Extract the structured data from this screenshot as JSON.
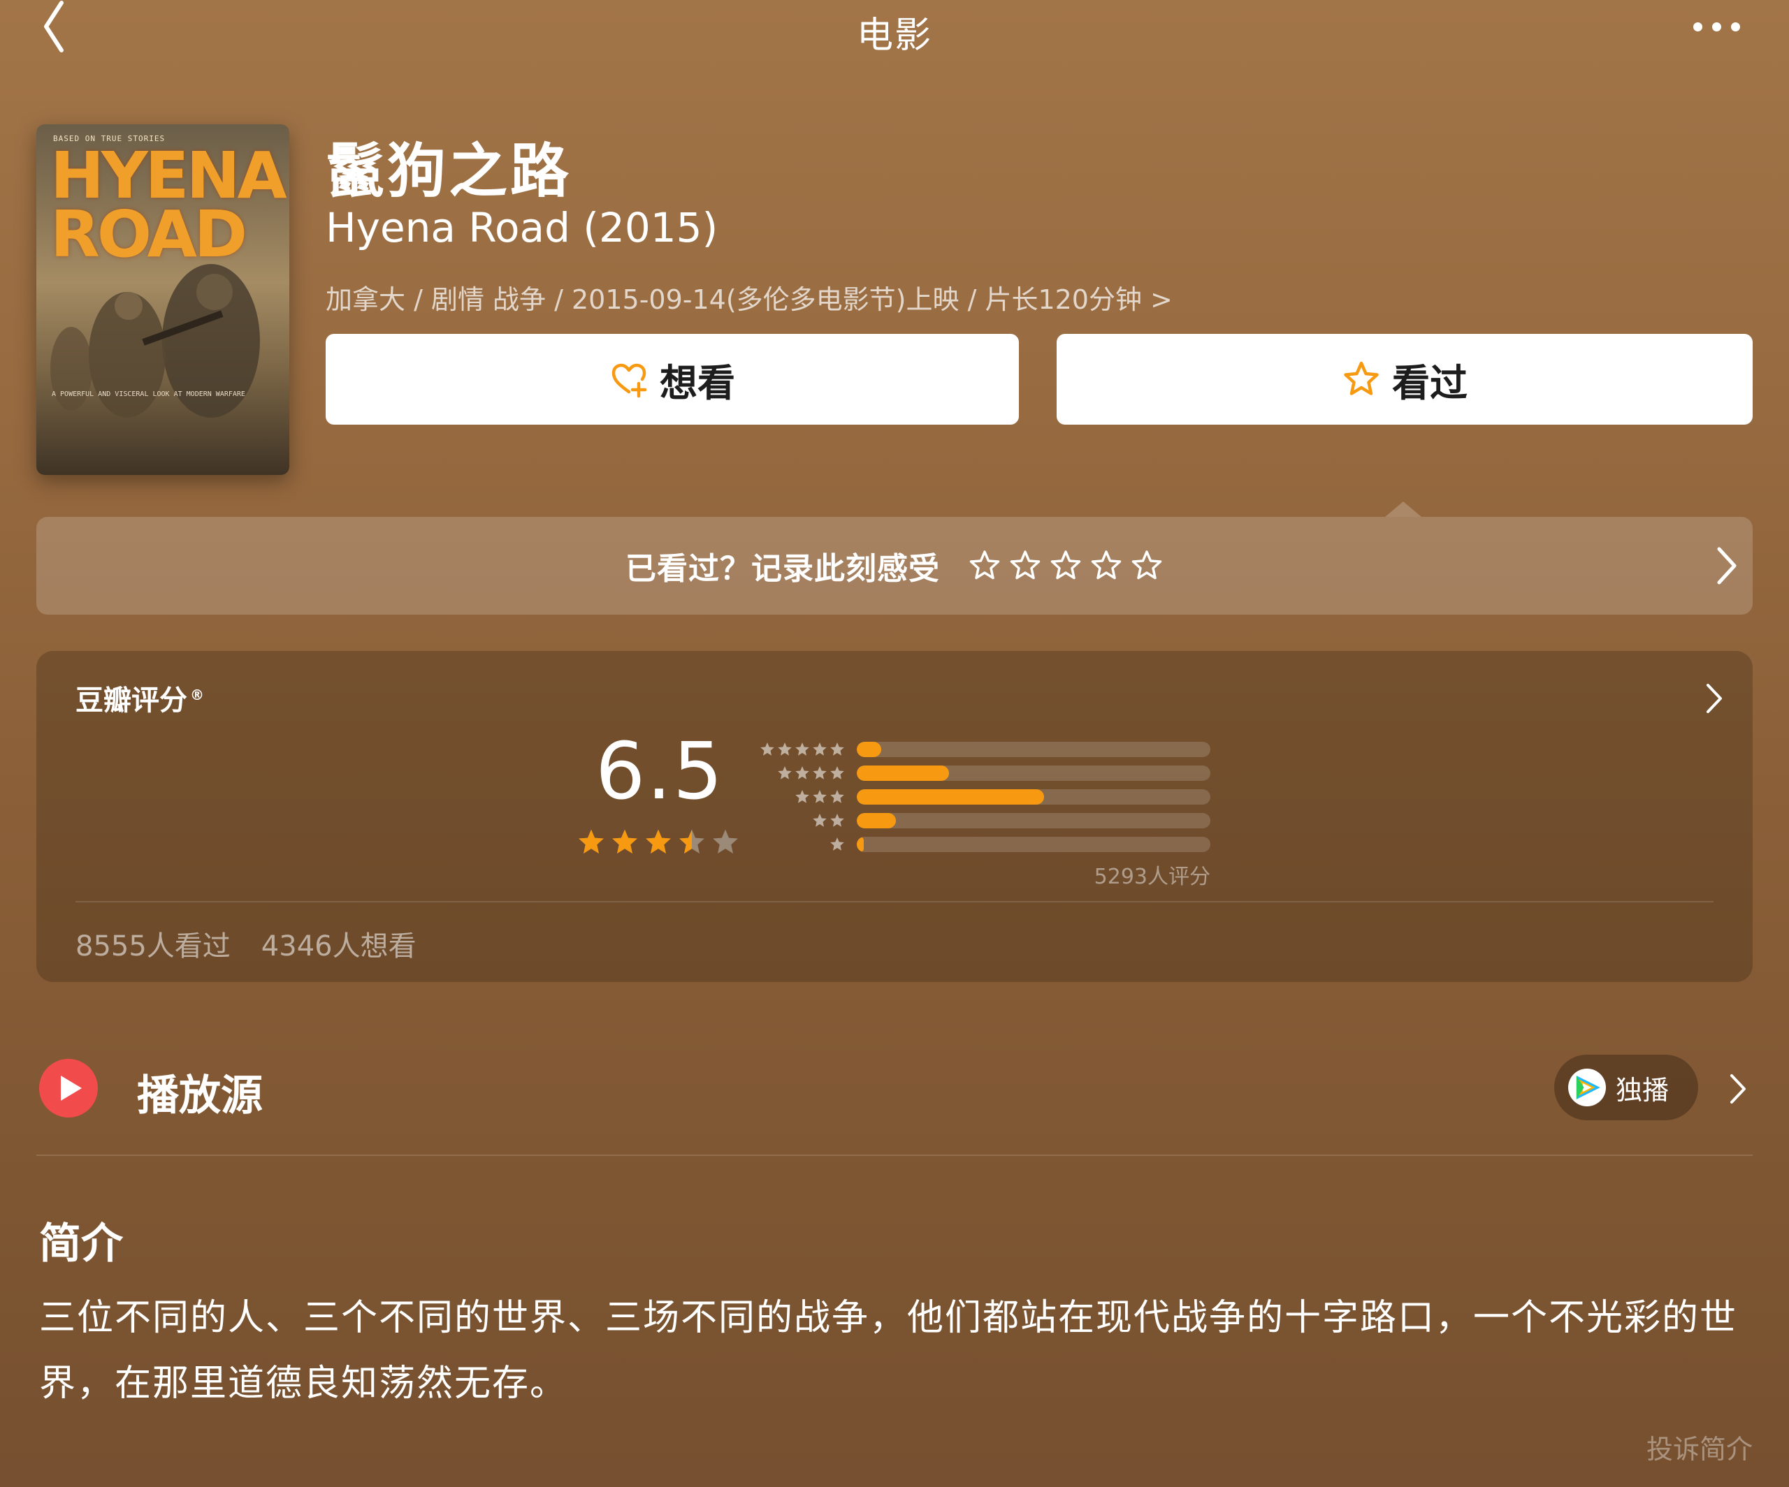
{
  "nav": {
    "title": "电影"
  },
  "poster": {
    "tagline": "BASED ON TRUE STORIES",
    "title_line1": "HYENA",
    "title_line2": "ROAD",
    "footer": "A POWERFUL AND VISCERAL LOOK AT MODERN WARFARE"
  },
  "movie": {
    "title_cn": "鬣狗之路",
    "title_en": "Hyena Road (2015)",
    "meta": "加拿大 / 剧情 战争 / 2015-09-14(多伦多电影节)上映 / 片长120分钟 >"
  },
  "actions": {
    "want_label": "想看",
    "seen_label": "看过"
  },
  "record": {
    "prompt": "已看过？记录此刻感受"
  },
  "rating": {
    "header": "豆瓣评分",
    "registered_mark": "®",
    "score": "6.5",
    "score_stars": 3.5,
    "distribution": [
      {
        "stars": 5,
        "fraction": 0.07
      },
      {
        "stars": 4,
        "fraction": 0.26
      },
      {
        "stars": 3,
        "fraction": 0.53
      },
      {
        "stars": 2,
        "fraction": 0.11
      },
      {
        "stars": 1,
        "fraction": 0.02
      }
    ],
    "count": "5293人评分",
    "seen": "8555人看过",
    "want": "4346人想看"
  },
  "play": {
    "title": "播放源",
    "badge": "独播"
  },
  "synopsis": {
    "title": "简介",
    "body": "三位不同的人、三个不同的世界、三场不同的战争，他们都站在现代战争的十字路口，一个不光彩的世界，在那里道德良知荡然无存。",
    "report": "投诉简介"
  },
  "colors": {
    "accent": "#f79a12",
    "play_red": "#f24b4b",
    "star_gray": "#9b8a78"
  }
}
